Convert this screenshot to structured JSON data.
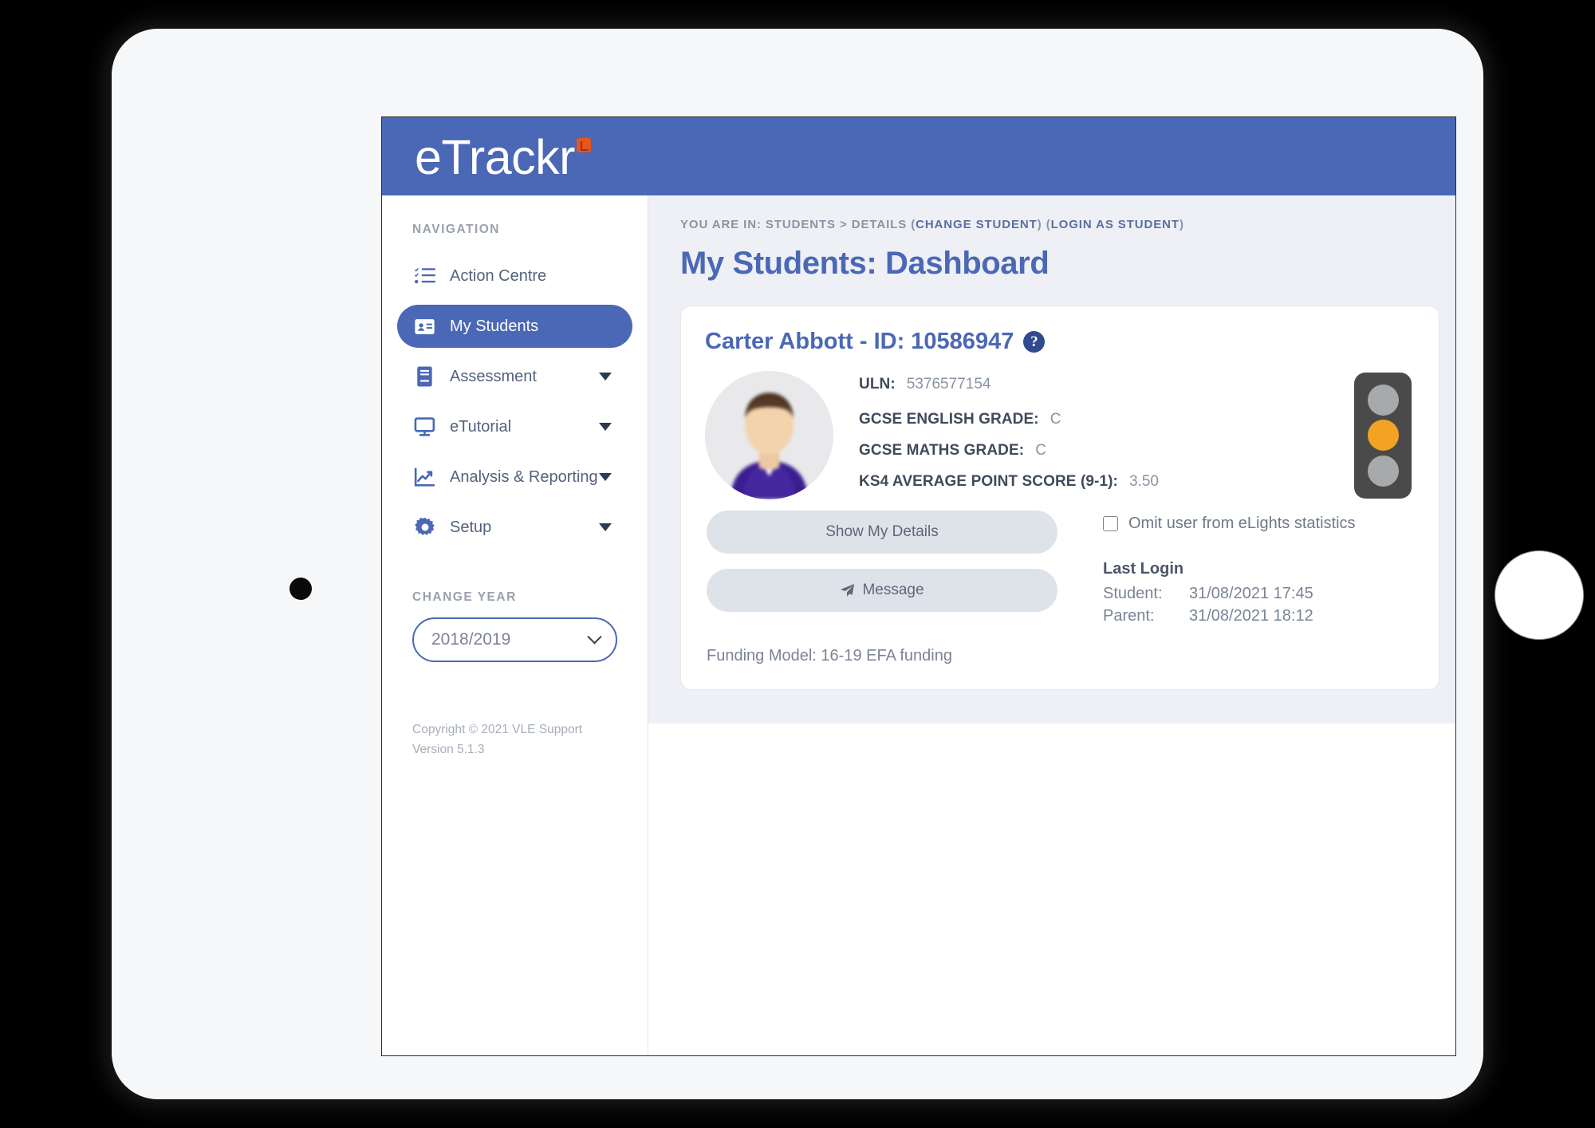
{
  "brand": {
    "logo_text": "eTrackr",
    "logo_badge_icon": "orange-square-badge",
    "bar_color": "#4a68b5",
    "badge_color": "#e8551f"
  },
  "sidebar": {
    "section_label": "NAVIGATION",
    "items": [
      {
        "label": "Action Centre",
        "icon": "tasks-list-icon",
        "active": false,
        "has_caret": false
      },
      {
        "label": "My Students",
        "icon": "id-card-icon",
        "active": true,
        "has_caret": false
      },
      {
        "label": "Assessment",
        "icon": "book-icon",
        "active": false,
        "has_caret": true
      },
      {
        "label": "eTutorial",
        "icon": "desktop-icon",
        "active": false,
        "has_caret": true
      },
      {
        "label": "Analysis & Reporting",
        "icon": "line-chart-icon",
        "active": false,
        "has_caret": true
      },
      {
        "label": "Setup",
        "icon": "gear-icon",
        "active": false,
        "has_caret": true
      }
    ],
    "change_year_label": "CHANGE YEAR",
    "year_selected": "2018/2019",
    "footer_copyright": "Copyright © 2021 VLE Support",
    "footer_version": "Version 5.1.3"
  },
  "breadcrumb": {
    "prefix": "YOU ARE IN: STUDENTS > DETAILS",
    "change_student": "CHANGE STUDENT",
    "login_as_student": "LOGIN AS STUDENT"
  },
  "page": {
    "title": "My Students: Dashboard"
  },
  "student_card": {
    "heading": "Carter Abbott - ID: 10586947",
    "help_glyph": "?",
    "avatar_icon": "student-photo-avatar",
    "fields": [
      {
        "key": "ULN:",
        "value": "5376577154"
      },
      {
        "key": "GCSE ENGLISH GRADE:",
        "value": "C"
      },
      {
        "key": "GCSE MATHS GRADE:",
        "value": "C"
      },
      {
        "key": "KS4 AVERAGE POINT SCORE (9-1):",
        "value": "3.50"
      }
    ],
    "traffic_light": {
      "icon": "traffic-light-icon",
      "lamps": [
        "off",
        "amber",
        "off"
      ],
      "amber_color": "#f3a324",
      "off_color": "#a8a9ab",
      "body_color": "#4a4a4a"
    },
    "buttons": {
      "show_details": "Show My Details",
      "message": "Message",
      "message_icon": "paper-plane-icon"
    },
    "omit_checkbox": {
      "label": "Omit user from eLights statistics",
      "checked": false
    },
    "last_login": {
      "title": "Last Login",
      "rows": [
        {
          "who": "Student:",
          "when": "31/08/2021 17:45"
        },
        {
          "who": "Parent:",
          "when": "31/08/2021 18:12"
        }
      ]
    },
    "funding_model": "Funding Model: 16-19 EFA funding"
  }
}
